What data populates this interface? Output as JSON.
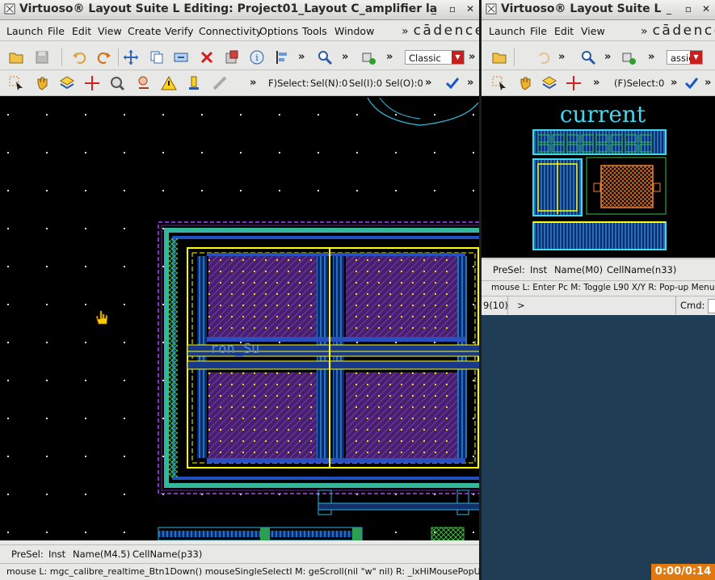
{
  "left_window": {
    "title": "Virtuoso® Layout Suite L Editing: Project01_Layout C_amplifier la",
    "menus": [
      "Launch",
      "File",
      "Edit",
      "View",
      "Create",
      "Verify",
      "Connectivity",
      "Options",
      "Tools",
      "Window"
    ],
    "brand": "cādence",
    "toolbar1": {
      "mode_combo": "Classic"
    },
    "toolbar2": {
      "select_prefix": "F)Select:",
      "sel_n": "Sel(N):0",
      "sel_i": "Sel(I):0",
      "sel_o": "Sel(O):0"
    },
    "canvas": {
      "pin_label": "ron_Su"
    },
    "status": {
      "presel": "PreSel:",
      "type": "Inst",
      "name": "Name(M4.5)",
      "cell": "CellName(p33)"
    },
    "mouse_help": "mouse L: mgc_calibre_realtime_Btn1Down() mouseSingleSelectI   M: geScroll(nil \"w\"   nil)    R: _lxHiMousePopUp()"
  },
  "right_window": {
    "title": "Virtuoso® Layout Suite L",
    "menus": [
      "Launch",
      "File",
      "Edit",
      "View"
    ],
    "brand": "cādence",
    "toolbar1": {
      "mode_combo": "assic"
    },
    "toolbar2": {
      "select_prefix": "(F)Select:0"
    },
    "canvas": {
      "cell_label": "current"
    },
    "status": {
      "presel": "PreSel:",
      "type": "Inst",
      "name": "Name(M0)",
      "cell": "CellName(n33)"
    },
    "mouse_help": "mouse L: Enter Pc  M: Toggle L90 X/Y    R: Pop-up Menu",
    "cmd_line": {
      "history": "9(10)",
      "prompt": ">",
      "cmd_label": "Cmd:"
    },
    "timer": "0:00/0:14"
  },
  "colors": {
    "canvas_bg": "#000000",
    "highlight_yellow": "#ffff00",
    "cyan": "#00e5ff",
    "purple": "#6a2a9a",
    "dashed_magenta": "#b040ff"
  }
}
